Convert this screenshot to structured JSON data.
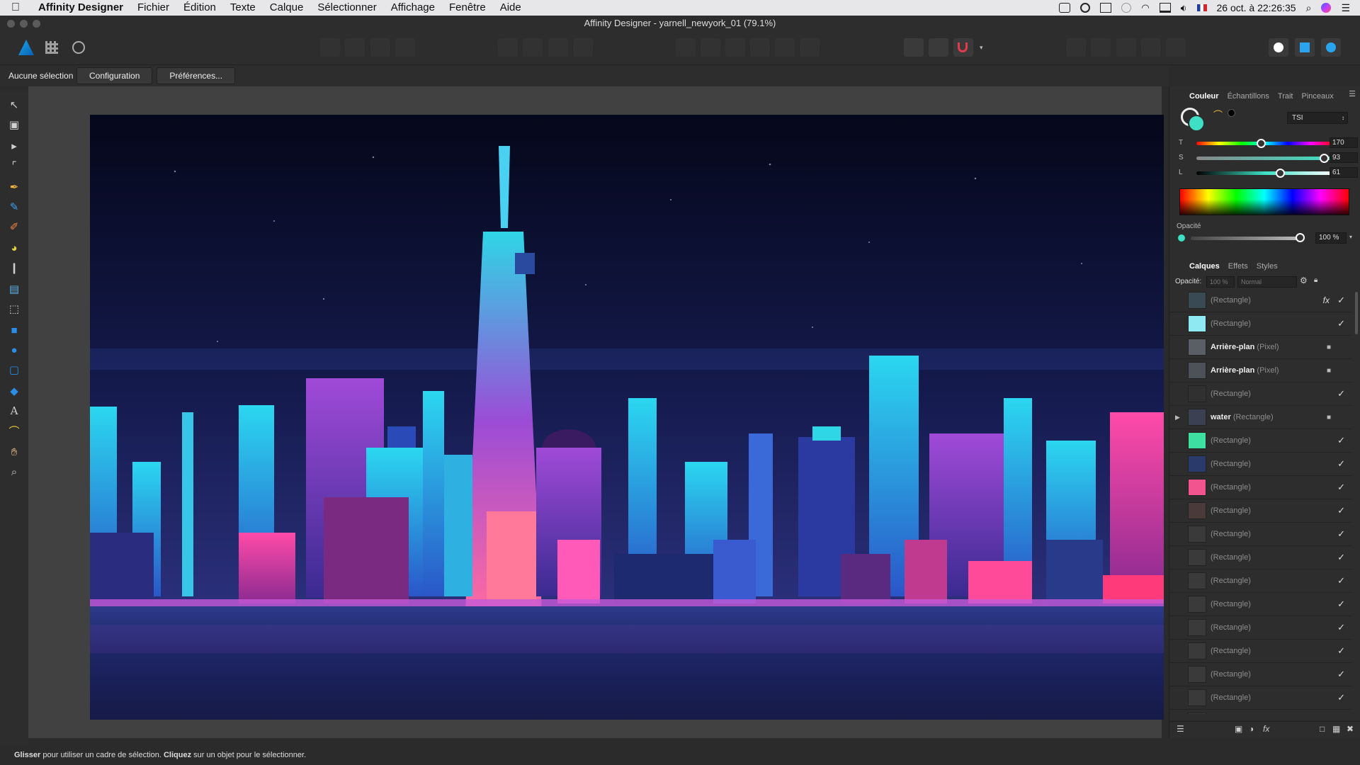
{
  "menubar": {
    "app": "Affinity Designer",
    "items": [
      "Fichier",
      "Édition",
      "Texte",
      "Calque",
      "Sélectionner",
      "Affichage",
      "Fenêtre",
      "Aide"
    ],
    "datetime": "26 oct. à 22:26:35"
  },
  "window": {
    "title": "Affinity Designer - yarnell_newyork_01 (79.1%)"
  },
  "contextbar": {
    "selection": "Aucune sélection",
    "config_label": "Configuration",
    "prefs_label": "Préférences..."
  },
  "color_panel": {
    "tabs": [
      "Couleur",
      "Échantillons",
      "Trait",
      "Pinceaux"
    ],
    "model": "TSI",
    "sliders": [
      {
        "label": "T",
        "value": "170",
        "fraction": 0.47
      },
      {
        "label": "S",
        "value": "93",
        "fraction": 0.93
      },
      {
        "label": "L",
        "value": "61",
        "fraction": 0.61
      }
    ],
    "opacity_label": "Opacité",
    "opacity_value": "100 %",
    "fill_color": "#3de0c4"
  },
  "layers_panel": {
    "tabs": [
      "Calques",
      "Effets",
      "Styles"
    ],
    "opacity_label": "Opacité:",
    "opacity_value": "100 %",
    "blend_mode": "Normal",
    "rows": [
      {
        "name": "",
        "type": "(Rectangle)",
        "thumb": "#3a4a55",
        "fx": true,
        "locked": false
      },
      {
        "name": "",
        "type": "(Rectangle)",
        "thumb": "#8fe9f2",
        "fx": false,
        "locked": false
      },
      {
        "name": "Arrière-plan",
        "type": "(Pixel)",
        "thumb": "#5a5f66",
        "fx": false,
        "locked": true
      },
      {
        "name": "Arrière-plan",
        "type": "(Pixel)",
        "thumb": "#4d5158",
        "fx": false,
        "locked": true
      },
      {
        "name": "",
        "type": "(Rectangle)",
        "thumb": "#303030",
        "fx": false,
        "locked": false
      },
      {
        "name": "water",
        "type": "(Rectangle)",
        "thumb": "#3b4052",
        "fx": false,
        "locked": true
      },
      {
        "name": "",
        "type": "(Rectangle)",
        "thumb": "#3de0a0",
        "fx": false,
        "locked": false
      },
      {
        "name": "",
        "type": "(Rectangle)",
        "thumb": "#2a3a6a",
        "fx": false,
        "locked": false
      },
      {
        "name": "",
        "type": "(Rectangle)",
        "thumb": "#f2548f",
        "fx": false,
        "locked": false
      },
      {
        "name": "",
        "type": "(Rectangle)",
        "thumb": "#4b3a3a",
        "fx": false,
        "locked": false
      },
      {
        "name": "",
        "type": "(Rectangle)",
        "thumb": "#3a3a3a",
        "fx": false,
        "locked": false
      },
      {
        "name": "",
        "type": "(Rectangle)",
        "thumb": "#3a3a3a",
        "fx": false,
        "locked": false
      },
      {
        "name": "",
        "type": "(Rectangle)",
        "thumb": "#3a3a3a",
        "fx": false,
        "locked": false
      },
      {
        "name": "",
        "type": "(Rectangle)",
        "thumb": "#3a3a3a",
        "fx": false,
        "locked": false
      },
      {
        "name": "",
        "type": "(Rectangle)",
        "thumb": "#3a3a3a",
        "fx": false,
        "locked": false
      },
      {
        "name": "",
        "type": "(Rectangle)",
        "thumb": "#3a3a3a",
        "fx": false,
        "locked": false
      },
      {
        "name": "",
        "type": "(Rectangle)",
        "thumb": "#3a3a3a",
        "fx": false,
        "locked": false
      },
      {
        "name": "",
        "type": "(Rectangle)",
        "thumb": "#3a3a3a",
        "fx": false,
        "locked": false
      },
      {
        "name": "",
        "type": "(Rectangle)",
        "thumb": "#3a3a3a",
        "fx": false,
        "locked": false
      }
    ]
  },
  "status": {
    "bold1": "Glisser",
    "text1": " pour utiliser un cadre de sélection. ",
    "bold2": "Cliquez",
    "text2": " sur un objet pour le sélectionner."
  }
}
